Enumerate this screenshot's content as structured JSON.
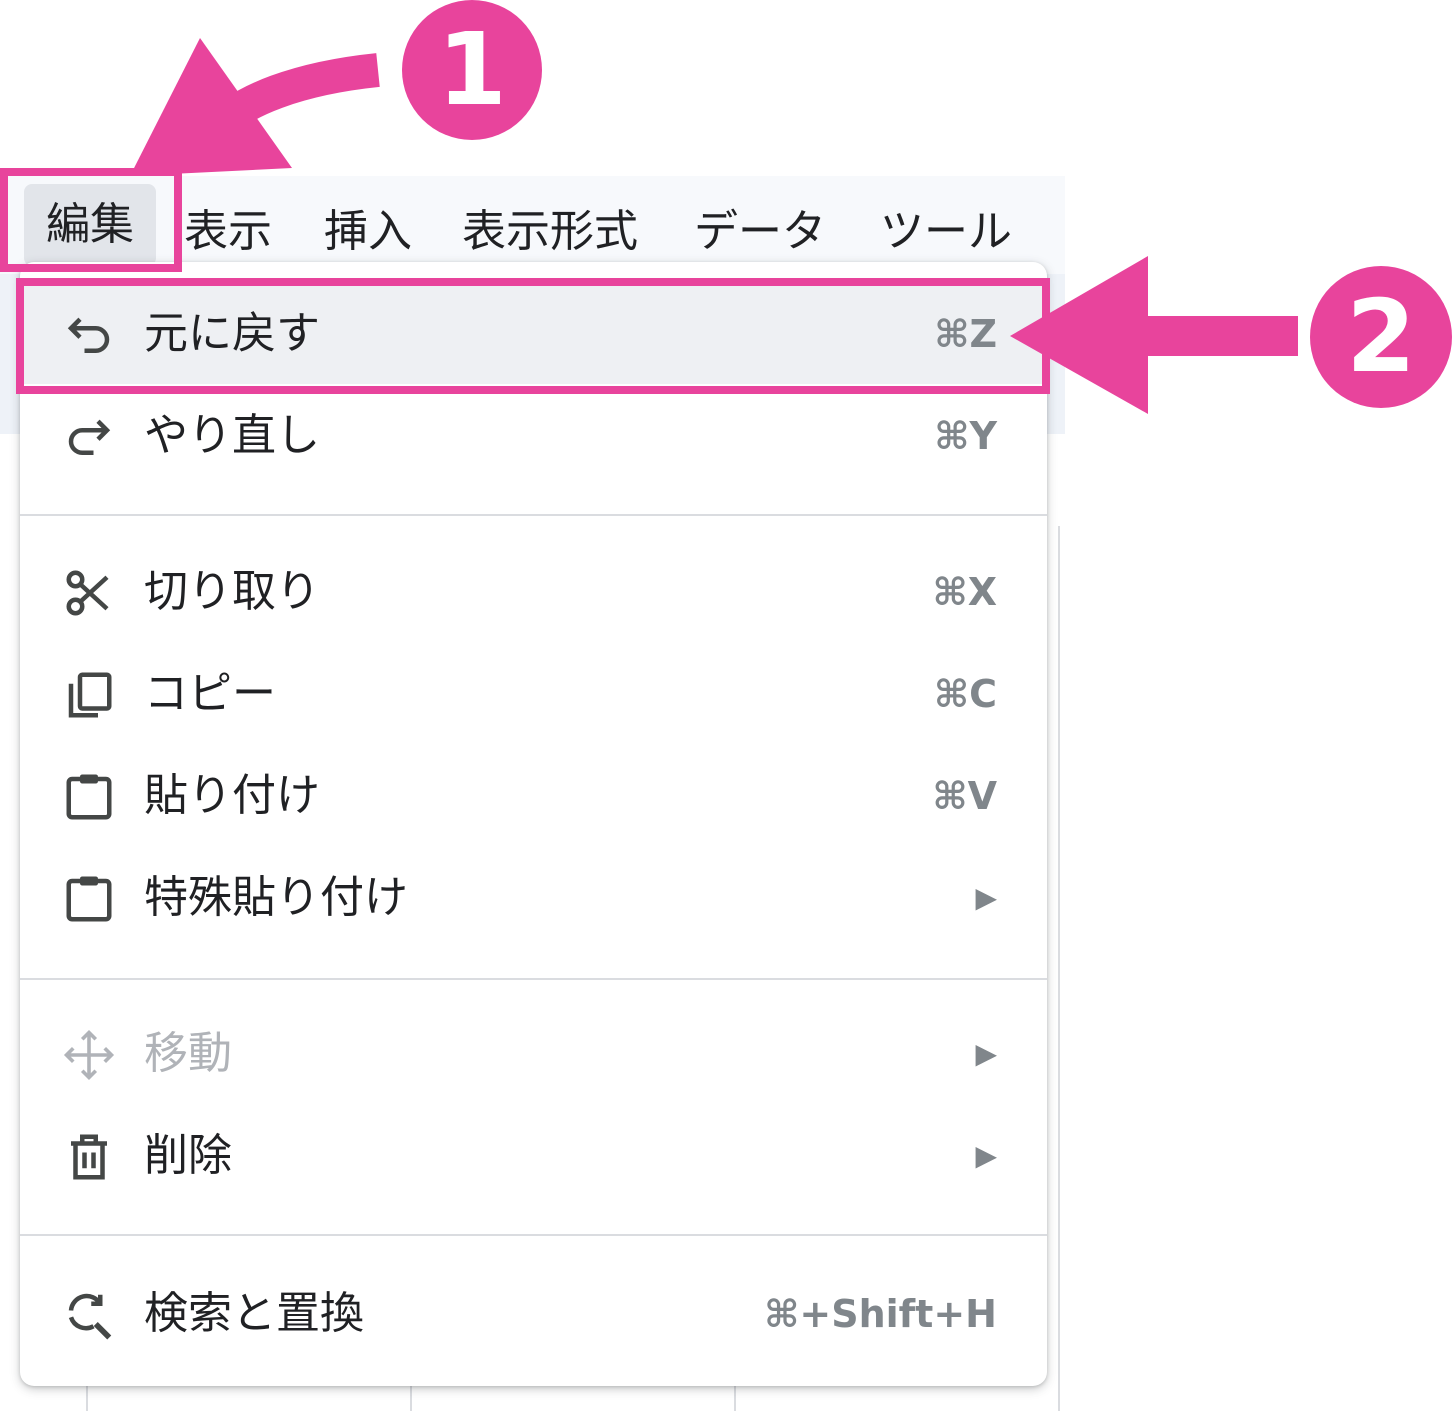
{
  "menubar": {
    "items": [
      {
        "label": "編集",
        "active": true
      },
      {
        "label": "表示"
      },
      {
        "label": "挿入"
      },
      {
        "label": "表示形式"
      },
      {
        "label": "データ"
      },
      {
        "label": "ツール"
      }
    ]
  },
  "menu": {
    "items": [
      {
        "icon": "undo-icon",
        "label": "元に戻す",
        "shortcut": "⌘Z",
        "highlighted": true
      },
      {
        "icon": "redo-icon",
        "label": "やり直し",
        "shortcut": "⌘Y"
      },
      {
        "icon": "scissors-icon",
        "label": "切り取り",
        "shortcut": "⌘X"
      },
      {
        "icon": "copy-icon",
        "label": "コピー",
        "shortcut": "⌘C"
      },
      {
        "icon": "clipboard-icon",
        "label": "貼り付け",
        "shortcut": "⌘V"
      },
      {
        "icon": "clipboard-icon",
        "label": "特殊貼り付け",
        "submenu": "▶"
      },
      {
        "icon": "move-arrows-icon",
        "label": "移動",
        "submenu": "▶",
        "disabled": true
      },
      {
        "icon": "trash-icon",
        "label": "削除",
        "submenu": "▶"
      },
      {
        "icon": "find-replace-icon",
        "label": "検索と置換",
        "shortcut": "⌘+Shift+H"
      }
    ]
  },
  "annotations": {
    "step1": "1",
    "step2": "2",
    "color": "#e8449c"
  }
}
